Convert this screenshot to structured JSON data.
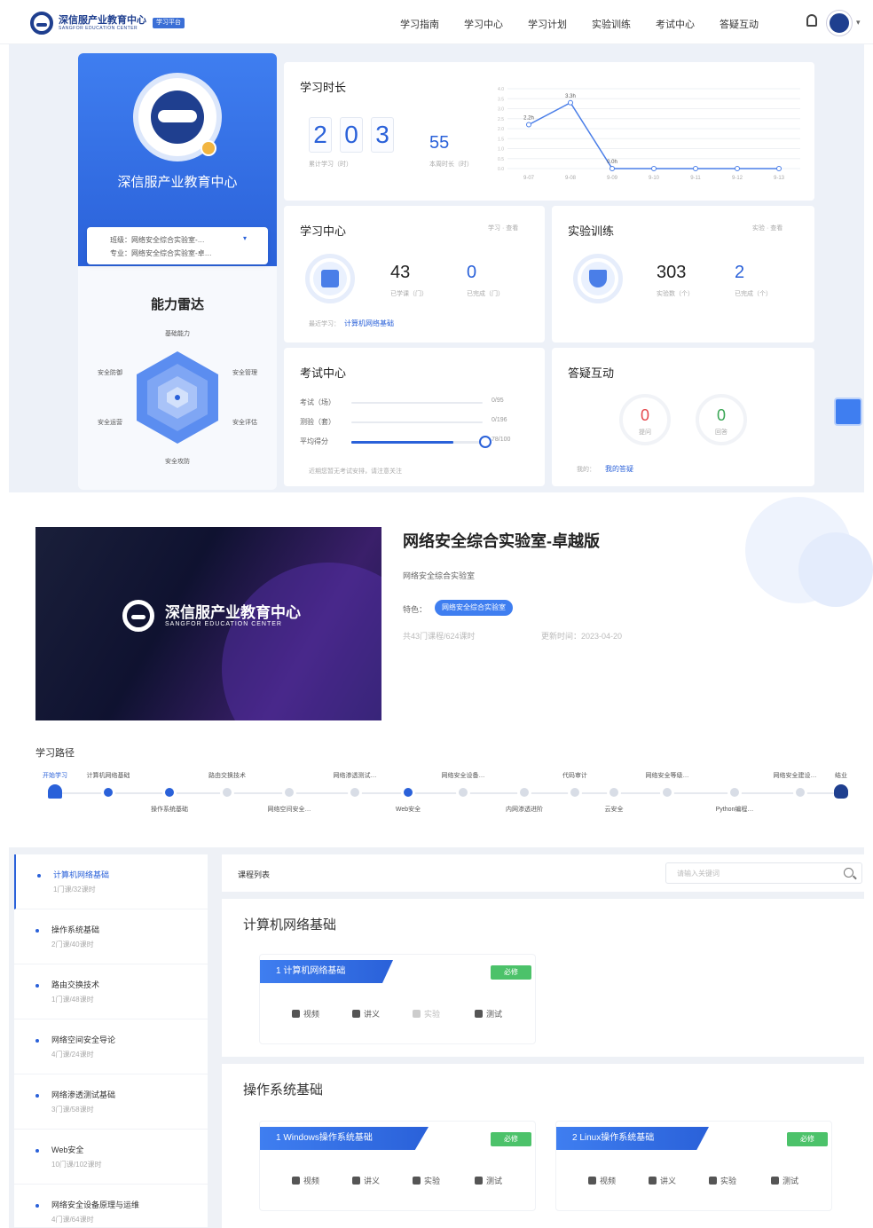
{
  "header": {
    "logo_cn": "深信服产业教育中心",
    "logo_en": "SANGFOR EDUCATION CENTER",
    "logo_tag": "学习平台",
    "nav": [
      "学习指南",
      "学习中心",
      "学习计划",
      "实验训练",
      "考试中心",
      "答疑互动"
    ]
  },
  "profile": {
    "org_name": "深信服产业教育中心",
    "major_line1": "班级：网络安全综合实验室-…",
    "major_line2": "专业：网络安全综合实验室-卓…",
    "radar_title": "能力雷达",
    "radar_labels": [
      "基础能力",
      "安全防御",
      "安全管理",
      "安全运营",
      "安全评估",
      "安全攻防"
    ]
  },
  "study_time": {
    "title": "学习时长",
    "digits": [
      "2",
      "0",
      "3"
    ],
    "total_label": "累计学习（时）",
    "week_value": "55",
    "week_label": "本周时长（时）",
    "chart_data": {
      "type": "line",
      "x": [
        "9-07",
        "9-08",
        "9-09",
        "9-10",
        "9-11",
        "9-12",
        "9-13"
      ],
      "values": [
        2.2,
        3.3,
        0,
        0,
        0,
        0,
        0
      ],
      "point_labels": [
        "2.2h",
        "3.3h",
        "0.0h",
        "",
        "",
        "",
        ""
      ],
      "ylim": [
        0,
        4
      ],
      "grid": true
    }
  },
  "study_center": {
    "title": "学习中心",
    "corner": "学习 · 查看",
    "num1": "43",
    "lbl1": "已学课（门）",
    "num2": "0",
    "lbl2": "已完成（门）",
    "last_label": "最近学习：",
    "last_link": "计算机网络基础"
  },
  "lab": {
    "title": "实验训练",
    "corner": "实验 · 查看",
    "num1": "303",
    "lbl1": "实验数（个）",
    "num2": "2",
    "lbl2": "已完成（个）"
  },
  "exam": {
    "title": "考试中心",
    "rows": [
      {
        "label": "考试（场）",
        "value": "0/95",
        "progress": 0
      },
      {
        "label": "测验（套）",
        "value": "0/196",
        "progress": 0
      },
      {
        "label": "平均得分",
        "value": "78/100",
        "progress": 0.78
      }
    ],
    "footer": "近期您暂无考试安排，请注意关注"
  },
  "qa": {
    "title": "答疑互动",
    "num1": "0",
    "lbl1": "提问",
    "num2": "0",
    "lbl2": "回答",
    "footer_label": "我的：",
    "footer_link": "我的答疑"
  },
  "course": {
    "title": "网络安全综合实验室-卓越版",
    "subtitle": "网络安全综合实验室",
    "feature_label": "特色：",
    "feature_tag": "网络安全综合实验室",
    "meta1": "共43门课程/624课时",
    "meta2": "更新时间：2023-04-20",
    "image_logo_cn": "深信服产业教育中心",
    "image_logo_en": "SANGFOR EDUCATION CENTER"
  },
  "path": {
    "title": "学习路径",
    "start": "开始学习",
    "end": "结业",
    "top_labels": [
      "计算机网络基础",
      "路由交换技术",
      "网络渗透测试…",
      "网络安全设备…",
      "代码审计",
      "网络安全等级…",
      "网络安全建设…"
    ],
    "bottom_labels": [
      "操作系统基础",
      "网络空间安全…",
      "Web安全",
      "内网渗透进阶",
      "云安全",
      "Python编程…"
    ]
  },
  "course_list": {
    "header": "课程列表",
    "search_placeholder": "请输入关键词",
    "side": [
      {
        "name": "计算机网络基础",
        "meta": "1门课/32课时"
      },
      {
        "name": "操作系统基础",
        "meta": "2门课/40课时"
      },
      {
        "name": "路由交换技术",
        "meta": "1门课/48课时"
      },
      {
        "name": "网络空间安全导论",
        "meta": "4门课/24课时"
      },
      {
        "name": "网络渗透测试基础",
        "meta": "3门课/58课时"
      },
      {
        "name": "Web安全",
        "meta": "10门课/102课时"
      },
      {
        "name": "网络安全设备原理与运维",
        "meta": "4门课/64课时"
      }
    ],
    "sections": [
      {
        "title": "计算机网络基础",
        "lessons": [
          {
            "name": "1  计算机网络基础",
            "badge": "必修"
          }
        ]
      },
      {
        "title": "操作系统基础",
        "lessons": [
          {
            "name": "1  Windows操作系统基础",
            "badge": "必修"
          },
          {
            "name": "2  Linux操作系统基础",
            "badge": "必修"
          }
        ]
      }
    ],
    "actions": [
      "视频",
      "讲义",
      "实验",
      "测试"
    ]
  },
  "colors": {
    "primary": "#2a61d9",
    "required": "#4cc26a",
    "danger": "#e5484d",
    "success": "#3aa655"
  }
}
